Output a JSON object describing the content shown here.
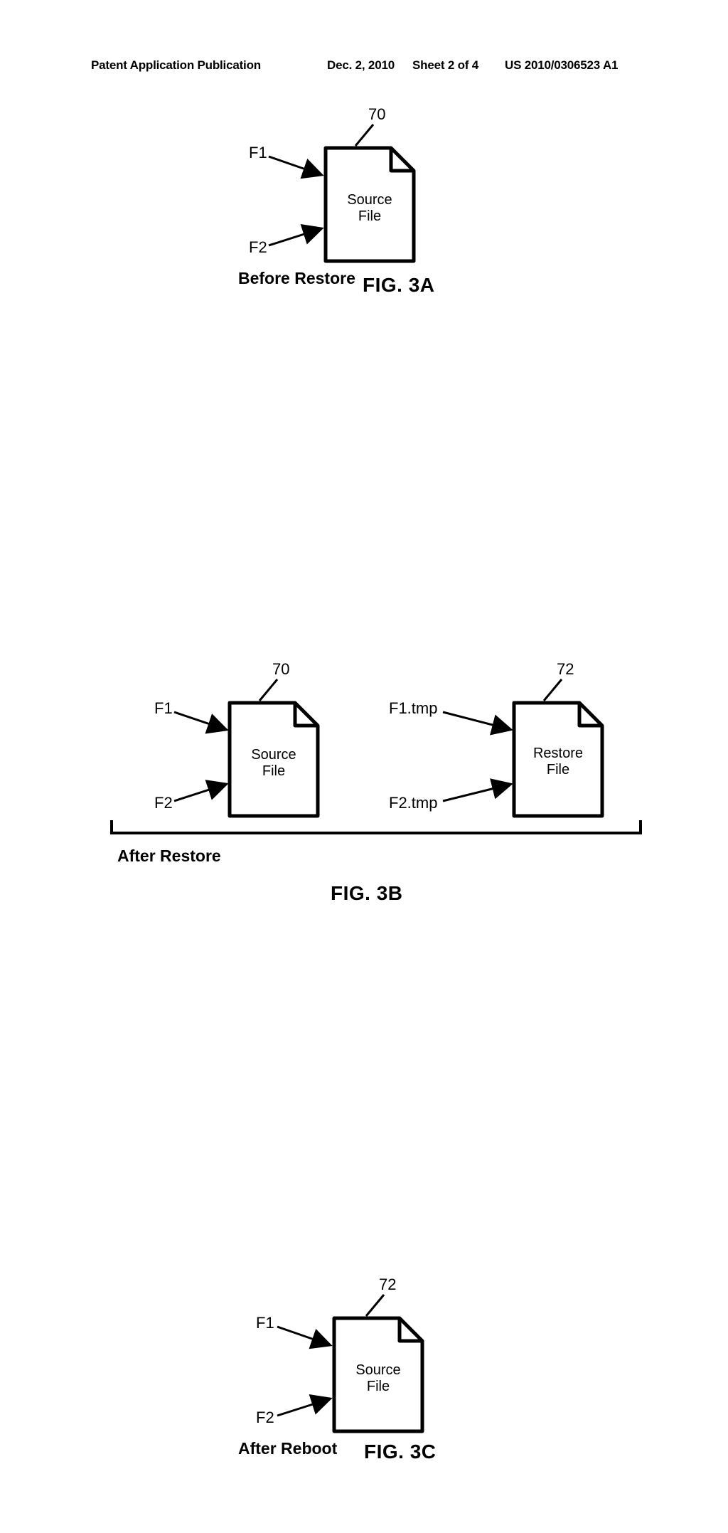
{
  "header": {
    "pub_type": "Patent Application Publication",
    "date": "Dec. 2, 2010",
    "sheet": "Sheet 2 of 4",
    "pub_no": "US 2010/0306523 A1"
  },
  "fig3a": {
    "ref_f1": "F1",
    "ref_f2": "F2",
    "num_70": "70",
    "file_label": "Source\nFile",
    "caption": "Before Restore",
    "fig": "FIG. 3A"
  },
  "fig3b": {
    "left": {
      "ref_f1": "F1",
      "ref_f2": "F2",
      "num_70": "70",
      "file_label": "Source\nFile"
    },
    "right": {
      "ref_f1": "F1.tmp",
      "ref_f2": "F2.tmp",
      "num_72": "72",
      "file_label": "Restore\nFile"
    },
    "caption": "After Restore",
    "fig": "FIG. 3B"
  },
  "fig3c": {
    "ref_f1": "F1",
    "ref_f2": "F2",
    "num_72": "72",
    "file_label": "Source\nFile",
    "caption": "After Reboot",
    "fig": "FIG. 3C"
  }
}
